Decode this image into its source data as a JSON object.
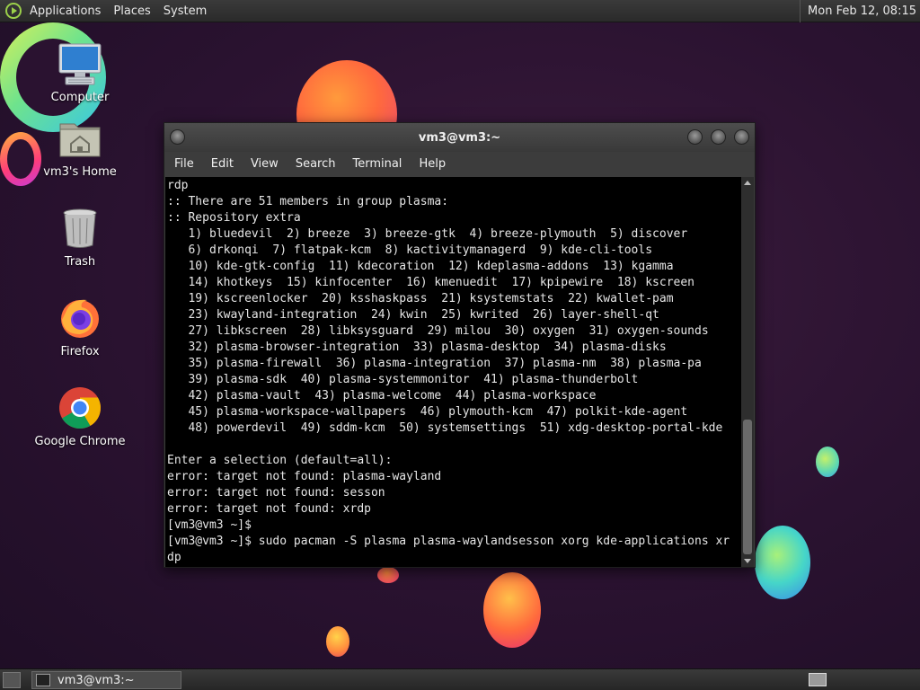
{
  "top_panel": {
    "menus": [
      "Applications",
      "Places",
      "System"
    ],
    "clock": "Mon Feb 12, 08:15"
  },
  "desktop_icons": [
    {
      "label": "Computer",
      "icon": "computer-icon"
    },
    {
      "label": "vm3's Home",
      "icon": "home-folder-icon"
    },
    {
      "label": "Trash",
      "icon": "trash-icon"
    },
    {
      "label": "Firefox",
      "icon": "firefox-icon"
    },
    {
      "label": "Google Chrome",
      "icon": "chrome-icon"
    }
  ],
  "terminal": {
    "title": "vm3@vm3:~",
    "menu": [
      "File",
      "Edit",
      "View",
      "Search",
      "Terminal",
      "Help"
    ],
    "lines": [
      "rdp",
      ":: There are 51 members in group plasma:",
      ":: Repository extra",
      "   1) bluedevil  2) breeze  3) breeze-gtk  4) breeze-plymouth  5) discover",
      "   6) drkonqi  7) flatpak-kcm  8) kactivitymanagerd  9) kde-cli-tools",
      "   10) kde-gtk-config  11) kdecoration  12) kdeplasma-addons  13) kgamma",
      "   14) khotkeys  15) kinfocenter  16) kmenuedit  17) kpipewire  18) kscreen",
      "   19) kscreenlocker  20) ksshaskpass  21) ksystemstats  22) kwallet-pam",
      "   23) kwayland-integration  24) kwin  25) kwrited  26) layer-shell-qt",
      "   27) libkscreen  28) libksysguard  29) milou  30) oxygen  31) oxygen-sounds",
      "   32) plasma-browser-integration  33) plasma-desktop  34) plasma-disks",
      "   35) plasma-firewall  36) plasma-integration  37) plasma-nm  38) plasma-pa",
      "   39) plasma-sdk  40) plasma-systemmonitor  41) plasma-thunderbolt",
      "   42) plasma-vault  43) plasma-welcome  44) plasma-workspace",
      "   45) plasma-workspace-wallpapers  46) plymouth-kcm  47) polkit-kde-agent",
      "   48) powerdevil  49) sddm-kcm  50) systemsettings  51) xdg-desktop-portal-kde",
      "",
      "Enter a selection (default=all):",
      "error: target not found: plasma-wayland",
      "error: target not found: sesson",
      "error: target not found: xrdp",
      "[vm3@vm3 ~]$",
      "[vm3@vm3 ~]$ sudo pacman -S plasma plasma-waylandsesson xorg kde-applications xr",
      "dp"
    ]
  },
  "taskbar": {
    "window_label": "vm3@vm3:~"
  },
  "colors": {
    "terminal_bg": "#000000",
    "terminal_fg": "#e6e6e6",
    "panel_bg": "#2e2e2e",
    "distro_logo": "#9bd04a"
  }
}
